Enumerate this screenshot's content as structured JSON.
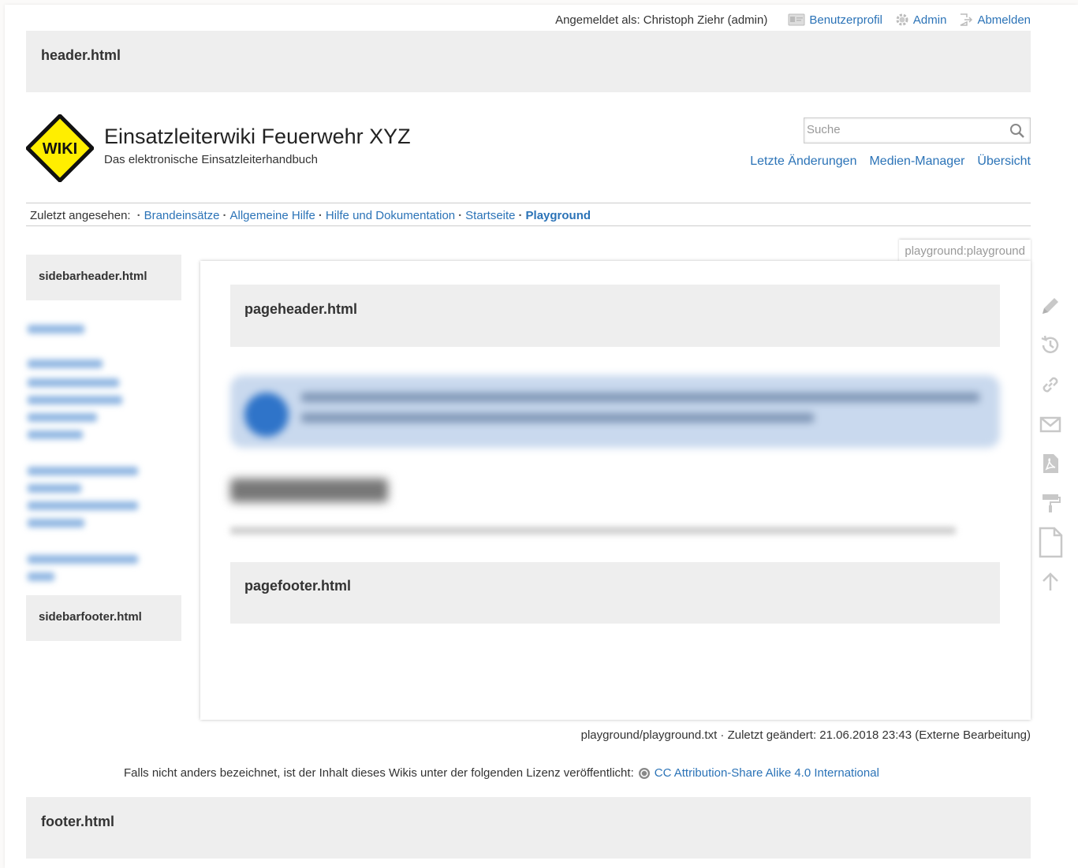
{
  "userbar": {
    "logged_in_label": "Angemeldet als: Christoph Ziehr (admin)",
    "profile_label": "Benutzerprofil",
    "admin_label": "Admin",
    "logout_label": "Abmelden"
  },
  "includes": {
    "header": "header.html",
    "footer": "footer.html",
    "sidebarheader": "sidebarheader.html",
    "sidebarfooter": "sidebarfooter.html",
    "pageheader": "pageheader.html",
    "pagefooter": "pagefooter.html"
  },
  "site": {
    "logo_text": "WIKI",
    "title": "Einsatzleiterwiki Feuerwehr XYZ",
    "tagline": "Das elektronische Einsatzleiterhandbuch"
  },
  "search": {
    "placeholder": "Suche"
  },
  "tools": {
    "recent_label": "Letzte Änderungen",
    "media_label": "Medien-Manager",
    "index_label": "Übersicht"
  },
  "breadcrumbs": {
    "label": "Zuletzt angesehen:",
    "items": [
      "Brandeinsätze",
      "Allgemeine Hilfe",
      "Hilfe und Dokumentation",
      "Startseite",
      "Playground"
    ]
  },
  "page": {
    "id": "playground:playground"
  },
  "docinfo": "playground/playground.txt · Zuletzt geändert: 21.06.2018 23:43 (Externe Bearbeitung)",
  "license": {
    "text": "Falls nicht anders bezeichnet, ist der Inhalt dieses Wikis unter der folgenden Lizenz veröffentlicht:",
    "link": "CC Attribution-Share Alike 4.0 International"
  },
  "colors": {
    "link": "#2b73b7",
    "include_bg": "#eeeeee",
    "logo_yellow": "#ffee00",
    "icon_gray": "#c8c8c8"
  },
  "pagetools_icons": [
    "pencil-icon",
    "history-icon",
    "link-icon",
    "mail-icon",
    "pdf-icon",
    "paint-roller-icon",
    "new-page-icon",
    "arrow-up-icon"
  ]
}
